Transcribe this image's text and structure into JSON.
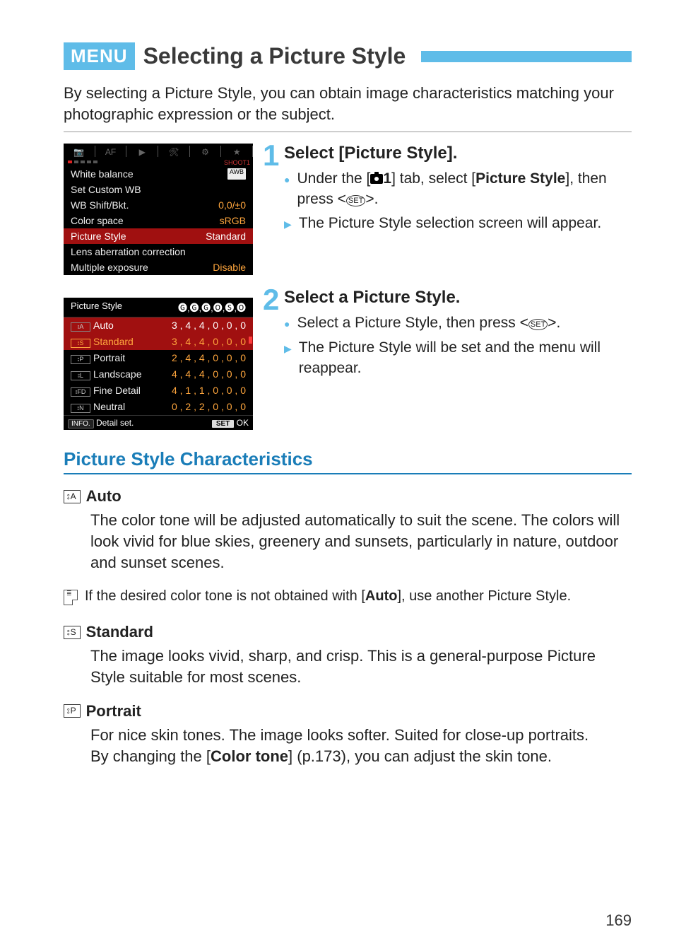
{
  "header": {
    "menu_badge": "MENU",
    "title": "Selecting a Picture Style"
  },
  "intro": "By selecting a Picture Style, you can obtain image characteristics matching your photographic expression or the subject.",
  "lcd1": {
    "tabs": [
      "📷",
      "AF",
      "▶",
      "🔧",
      "⚙",
      "★"
    ],
    "shoot_label": "SHOOT1",
    "rows": [
      {
        "label": "White balance",
        "value": "AWB"
      },
      {
        "label": "Set Custom WB",
        "value": ""
      },
      {
        "label": "WB Shift/Bkt.",
        "value": "0,0/±0"
      },
      {
        "label": "Color space",
        "value": "sRGB"
      },
      {
        "label": "Picture Style",
        "value": "Standard",
        "selected": true
      },
      {
        "label": "Lens aberration correction",
        "value": ""
      },
      {
        "label": "Multiple exposure",
        "value": "Disable"
      }
    ]
  },
  "lcd2": {
    "header_left": "Picture Style",
    "header_right_icons": "🅖,🅖,🅖,🅞,🅢,🅞",
    "rows": [
      {
        "icon": "A",
        "label": "Auto",
        "vals": "3 , 4 , 4 , 0 , 0 , 0",
        "sel": true
      },
      {
        "icon": "S",
        "label": "Standard",
        "vals": "3 , 4 , 4 , 0 , 0 , 0",
        "selOrange": true
      },
      {
        "icon": "P",
        "label": "Portrait",
        "vals": "2 , 4 , 4 , 0 , 0 , 0"
      },
      {
        "icon": "L",
        "label": "Landscape",
        "vals": "4 , 4 , 4 , 0 , 0 , 0"
      },
      {
        "icon": "FD",
        "label": "Fine Detail",
        "vals": "4 , 1 , 1 , 0 , 0 , 0"
      },
      {
        "icon": "N",
        "label": "Neutral",
        "vals": "0 , 2 , 2 , 0 , 0 , 0"
      }
    ],
    "bottom_info": "INFO.",
    "bottom_label": "Detail set.",
    "bottom_set": "SET",
    "bottom_ok": "OK"
  },
  "steps": [
    {
      "num": "1",
      "title": "Select [Picture Style].",
      "items": [
        {
          "type": "dot",
          "html_prefix": "Under the [",
          "cam": true,
          "html_mid": "1] tab, select [",
          "bold": "Picture Style",
          "html_suffix": "], then press <",
          "set": true,
          "tail": ">."
        },
        {
          "type": "tri",
          "text": "The Picture Style selection screen will appear."
        }
      ]
    },
    {
      "num": "2",
      "title": "Select a Picture Style.",
      "items": [
        {
          "type": "dot",
          "text_prefix": "Select a Picture Style, then press <",
          "set": true,
          "tail": ">."
        },
        {
          "type": "tri",
          "text": "The Picture Style will be set and the menu will reappear."
        }
      ]
    }
  ],
  "section_title": "Picture Style Characteristics",
  "chars": [
    {
      "badge": "A",
      "name": "Auto",
      "body": "The color tone will be adjusted automatically to suit the scene. The colors will look vivid for blue skies, greenery and sunsets, particularly in nature, outdoor and sunset scenes."
    }
  ],
  "note": {
    "prefix": "If the desired color tone is not obtained with [",
    "bold": "Auto",
    "suffix": "], use another Picture Style."
  },
  "chars2": [
    {
      "badge": "S",
      "name": "Standard",
      "body": "The image looks vivid, sharp, and crisp. This is a general-purpose Picture Style suitable for most scenes."
    },
    {
      "badge": "P",
      "name": "Portrait",
      "body_prefix": "For nice skin tones. The image looks softer. Suited for close-up portraits.\nBy changing the [",
      "bold": "Color tone",
      "body_suffix": "] (p.173), you can adjust the skin tone."
    }
  ],
  "page_number": "169"
}
